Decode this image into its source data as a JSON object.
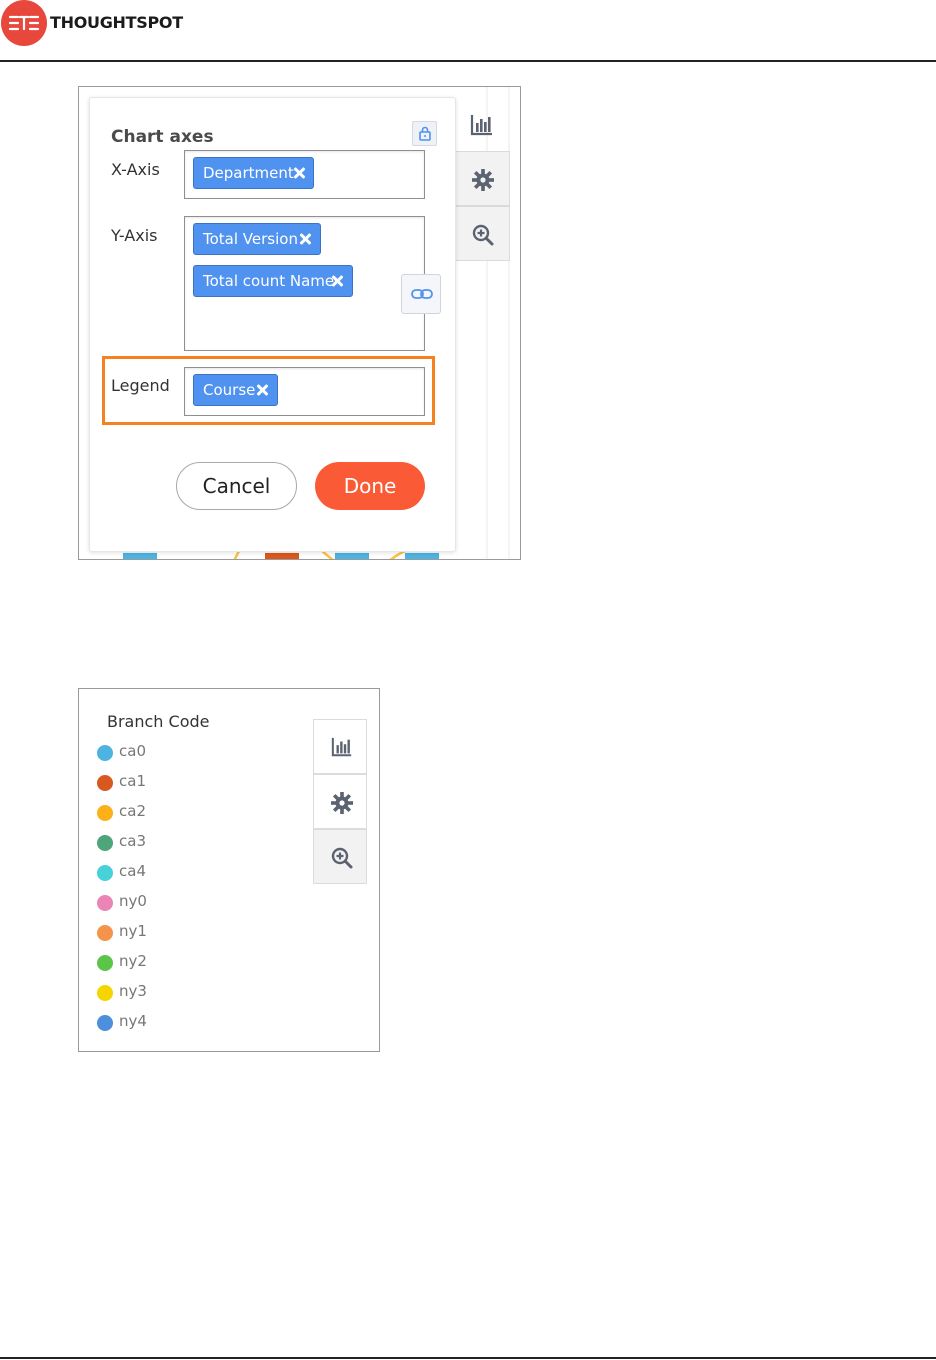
{
  "header": {
    "logo_text": "THOUGHTSPOT",
    "logo_icon": "thoughtspot-logo-icon",
    "logo_color": "#e8473c"
  },
  "chart_axes_panel": {
    "title": "Chart axes",
    "x_axis": {
      "label": "X-Axis",
      "chips": [
        "Department"
      ]
    },
    "y_axis": {
      "label": "Y-Axis",
      "chips": [
        "Total Version",
        "Total count Name"
      ]
    },
    "legend": {
      "label": "Legend",
      "chips": [
        "Course"
      ],
      "highlight_color": "#f58220"
    },
    "cancel_label": "Cancel",
    "done_label": "Done",
    "chip_color": "#4f92f0",
    "done_color": "#fa5a36"
  },
  "toolbar_icons": [
    "chart-type-icon",
    "gear-icon",
    "zoom-in-icon"
  ],
  "legend_panel": {
    "title": "Branch Code",
    "items": [
      {
        "label": "ca0",
        "color": "#4db3e0"
      },
      {
        "label": "ca1",
        "color": "#d9581f"
      },
      {
        "label": "ca2",
        "color": "#fbb117"
      },
      {
        "label": "ca3",
        "color": "#4ea57a"
      },
      {
        "label": "ca4",
        "color": "#47d1d9"
      },
      {
        "label": "ny0",
        "color": "#ea85b6"
      },
      {
        "label": "ny1",
        "color": "#f5934a"
      },
      {
        "label": "ny2",
        "color": "#5bc54a"
      },
      {
        "label": "ny3",
        "color": "#f5d500"
      },
      {
        "label": "ny4",
        "color": "#4d8fdc"
      }
    ]
  }
}
